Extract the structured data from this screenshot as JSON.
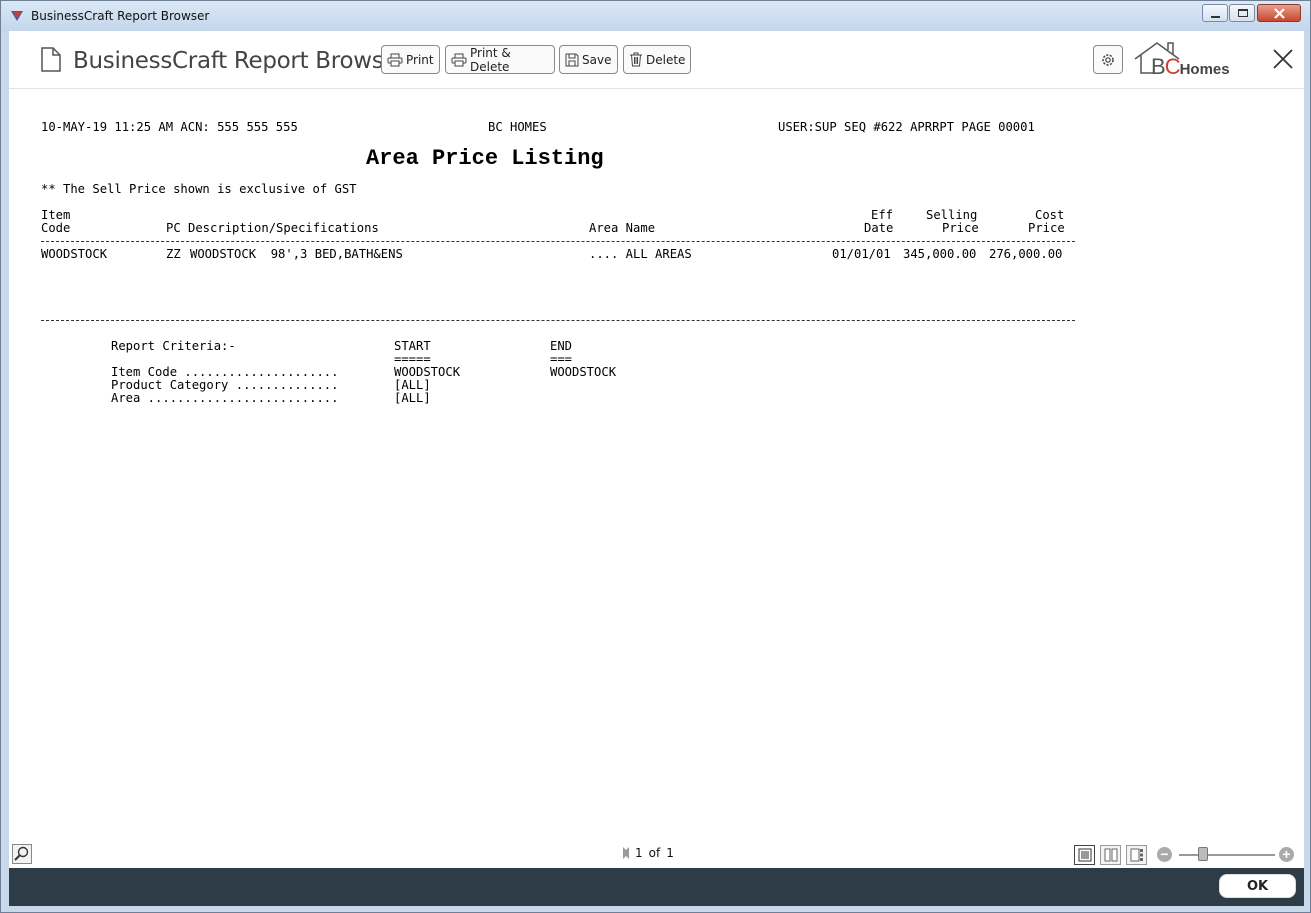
{
  "window": {
    "title": "BusinessCraft Report Browser"
  },
  "header": {
    "title": "BusinessCraft Report Browser",
    "buttons": {
      "print": "Print",
      "print_delete": "Print & Delete",
      "save": "Save",
      "delete": "Delete"
    },
    "logo": {
      "bc": "B",
      "c": "C",
      "homes": "Homes"
    }
  },
  "report": {
    "header_left": "10-MAY-19 11:25 AM ACN: 555 555 555",
    "header_center": "BC HOMES",
    "header_right": "USER:SUP SEQ #622 APRRPT PAGE 00001",
    "title": "Area Price Listing",
    "note": "** The Sell Price shown is exclusive of GST",
    "columns": {
      "item_line1": "Item",
      "item_line2": "Code",
      "pc_desc": "PC Description/Specifications",
      "area_name": "Area Name",
      "eff_line1": "Eff",
      "eff_line2": "Date",
      "sell_line1": "Selling",
      "sell_line2": "Price",
      "cost_line1": "Cost",
      "cost_line2": "Price"
    },
    "rows": [
      {
        "item_code": "WOODSTOCK",
        "pc": "ZZ",
        "description": "WOODSTOCK  98',3 BED,BATH&ENS",
        "area": ".... ALL AREAS",
        "eff_date": "01/01/01",
        "selling_price": "345,000.00",
        "cost_price": "276,000.00"
      }
    ],
    "criteria": {
      "label": "Report Criteria:-",
      "start_label": "START",
      "start_underline": "=====",
      "end_label": "END",
      "end_underline": "===",
      "items": [
        {
          "name": "Item Code .....................",
          "start": "WOODSTOCK",
          "end": "WOODSTOCK"
        },
        {
          "name": "Product Category ..............",
          "start": "[ALL]",
          "end": ""
        },
        {
          "name": "Area ..........................",
          "start": "[ALL]",
          "end": ""
        }
      ]
    }
  },
  "footer": {
    "page_current": "1",
    "page_of": "of",
    "page_total": "1",
    "ok_label": "OK"
  }
}
